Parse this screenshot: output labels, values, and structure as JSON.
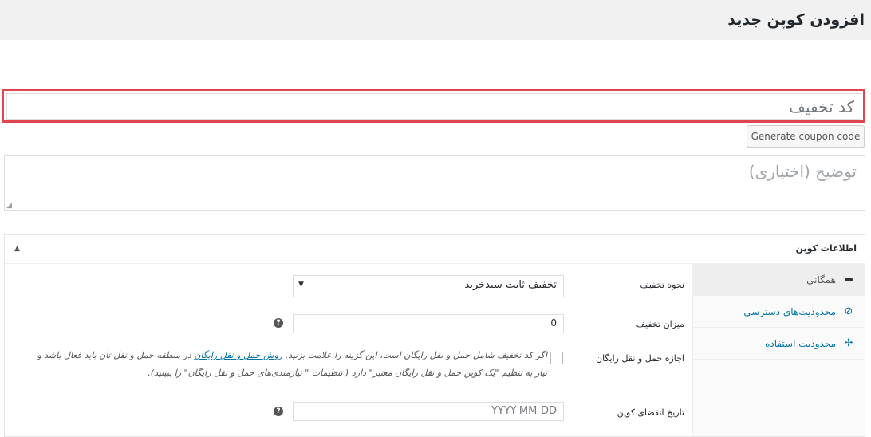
{
  "page": {
    "title": "افزودن کوپن جدید"
  },
  "coupon": {
    "code_placeholder": "کد تخفیف",
    "generate_label": "Generate coupon code",
    "description_placeholder": "توضیح (اختیاری)"
  },
  "panel": {
    "title": "اطلاعات کوپن",
    "tabs": [
      {
        "label": "همگانی",
        "icon": "ticket-icon"
      },
      {
        "label": "محدودیت‌های دسترسی",
        "icon": "block-icon"
      },
      {
        "label": "محدودیت استفاده",
        "icon": "usage-icon"
      }
    ],
    "fields": {
      "discount_type": {
        "label": "نحوه تخفیف",
        "value": "تخفیف ثابت سبدخرید"
      },
      "amount": {
        "label": "میزان تخفیف",
        "value": "0"
      },
      "free_shipping": {
        "label": "اجازه حمل و نقل رایگان",
        "desc_part1": "اگر کد تخفیف شامل حمل و نقل رایگان است، این گزینه را علامت بزنید.",
        "link_text": "روش حمل و نقل رایگان",
        "desc_part2": "در منطقه حمل و نقل تان باید فعال باشد و نیاز به تنظیم \"یک کوپن حمل و نقل رایگان معتبر\" دارد ( تنظیمات \" نیازمندی‌های حمل و نقل رایگان\" را ببینید)."
      },
      "expiry": {
        "label": "تاریخ انقضای کوپن",
        "placeholder": "YYYY-MM-DD"
      }
    }
  },
  "colors": {
    "highlight": "#e0454f",
    "link": "#0073aa"
  }
}
